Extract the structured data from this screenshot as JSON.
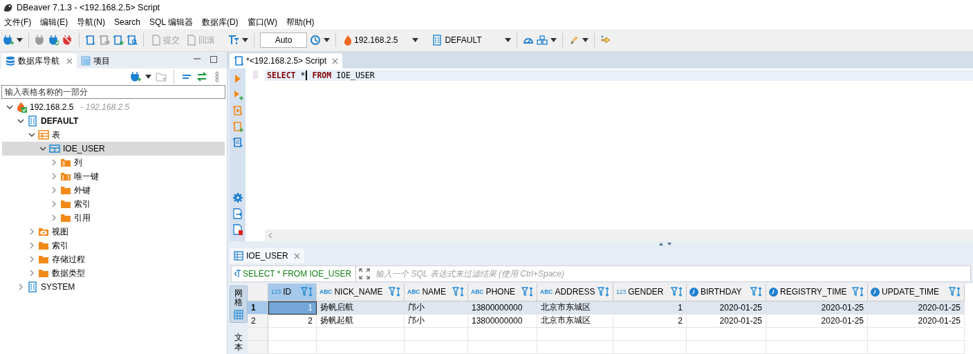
{
  "window": {
    "title": "DBeaver 7.1.3 - <192.168.2.5> Script"
  },
  "menu": [
    "文件(F)",
    "编辑(E)",
    "导航(N)",
    "Search",
    "SQL 编辑器",
    "数据库(D)",
    "窗口(W)",
    "帮助(H)"
  ],
  "toolbar": {
    "commit": {
      "label": "提交",
      "disabled": true
    },
    "rollback": {
      "label": "回滚",
      "disabled": true
    },
    "mode": {
      "value": "Auto"
    },
    "connection": "192.168.2.5",
    "schema": "DEFAULT"
  },
  "navigator": {
    "tabs": [
      {
        "label": "数据库导航",
        "selected": true
      },
      {
        "label": "项目",
        "selected": false
      }
    ],
    "filter": {
      "placeholder": "输入表格名称的一部分"
    },
    "tree": [
      {
        "label": "192.168.2.5",
        "note": "- 192.168.2.5",
        "kind": "connection",
        "expanded": true,
        "selected": false,
        "children": [
          {
            "label": "DEFAULT",
            "kind": "schema",
            "bold": true,
            "expanded": true,
            "selected": false,
            "children": [
              {
                "label": "表",
                "kind": "tables",
                "expanded": true,
                "selected": false,
                "children": [
                  {
                    "label": "IOE_USER",
                    "kind": "table",
                    "expanded": true,
                    "selected": true,
                    "children": [
                      {
                        "label": "列",
                        "kind": "columns",
                        "expanded": false,
                        "selected": false
                      },
                      {
                        "label": "唯一键",
                        "kind": "keys",
                        "expanded": false,
                        "selected": false
                      },
                      {
                        "label": "外键",
                        "kind": "folder",
                        "expanded": false,
                        "selected": false
                      },
                      {
                        "label": "索引",
                        "kind": "folder",
                        "expanded": false,
                        "selected": false
                      },
                      {
                        "label": "引用",
                        "kind": "folder",
                        "expanded": false,
                        "selected": false
                      }
                    ]
                  }
                ]
              },
              {
                "label": "视图",
                "kind": "views",
                "expanded": false,
                "selected": false
              },
              {
                "label": "索引",
                "kind": "folder",
                "expanded": false,
                "selected": false
              },
              {
                "label": "存储过程",
                "kind": "folder",
                "expanded": false,
                "selected": false
              },
              {
                "label": "数据类型",
                "kind": "folder",
                "expanded": false,
                "selected": false
              }
            ]
          },
          {
            "label": "SYSTEM",
            "kind": "schema",
            "bold": false,
            "expanded": false,
            "selected": false
          }
        ]
      }
    ]
  },
  "editor": {
    "tab": "*<192.168.2.5> Script",
    "code": [
      {
        "kind": "keyword",
        "text": "SELECT"
      },
      {
        "kind": "plain",
        "text": "*",
        "caret": true
      },
      {
        "kind": "keyword",
        "text": "FROM"
      },
      {
        "kind": "plain",
        "text": "IOE_USER"
      }
    ]
  },
  "results": {
    "tab": "IOE_USER",
    "query": "SELECT * FROM IOE_USER",
    "filter": {
      "placeholder": "输入一个 SQL 表达式来过滤结果 (使用 Ctrl+Space)"
    },
    "view_tabs": [
      {
        "label": "网格",
        "selected": true
      },
      {
        "label": "文本",
        "selected": false
      }
    ],
    "columns": [
      {
        "name": "ID",
        "kind": "number",
        "type_label": "123",
        "selected": true
      },
      {
        "name": "NICK_NAME",
        "kind": "string",
        "type_label": "ABC",
        "selected": false
      },
      {
        "name": "NAME",
        "kind": "string",
        "type_label": "ABC",
        "selected": false
      },
      {
        "name": "PHONE",
        "kind": "string",
        "type_label": "ABC",
        "selected": false
      },
      {
        "name": "ADDRESS",
        "kind": "string",
        "type_label": "ABC",
        "selected": false
      },
      {
        "name": "GENDER",
        "kind": "number",
        "type_label": "123",
        "selected": false
      },
      {
        "name": "BIRTHDAY",
        "kind": "date",
        "selected": false
      },
      {
        "name": "REGISTRY_TIME",
        "kind": "date",
        "selected": false
      },
      {
        "name": "UPDATE_TIME",
        "kind": "date",
        "selected": false
      }
    ],
    "rows": [
      {
        "number": "1",
        "selected": true,
        "cells": [
          "1",
          "扬帆启航",
          "邝小",
          "13800000000",
          "北京市东城区",
          "1",
          "2020-01-25",
          "2020-01-25",
          "2020-01-25"
        ]
      },
      {
        "number": "2",
        "selected": false,
        "cells": [
          "2",
          "扬帆起航",
          "邝小",
          "13800000000",
          "北京市东城区",
          "2",
          "2020-01-25",
          "2020-01-25",
          "2020-01-25"
        ]
      }
    ]
  }
}
